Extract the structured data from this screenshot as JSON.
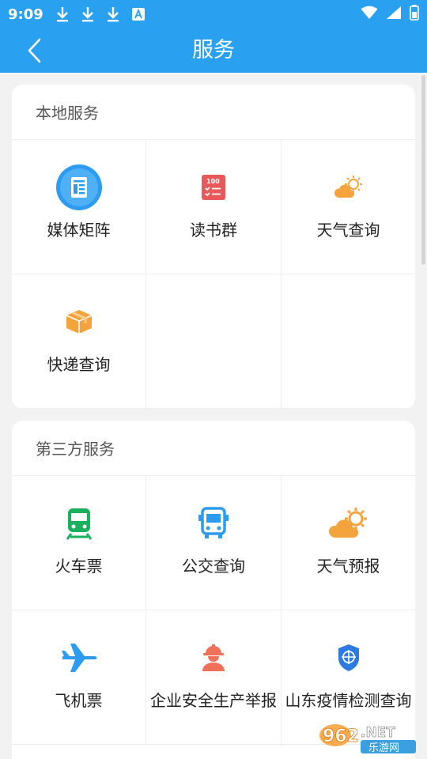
{
  "status_bar": {
    "time": "9:09",
    "left_icons": [
      "download-icon",
      "download-icon",
      "download-icon",
      "a-badge-icon"
    ],
    "right_icons": [
      "wifi-icon",
      "signal-icon",
      "battery-icon"
    ]
  },
  "app_bar": {
    "title": "服务",
    "back_icon": "chevron-left-icon",
    "background": "#2aa1f0"
  },
  "local_services": {
    "title": "本地服务",
    "items": [
      {
        "label": "媒体矩阵",
        "icon": "media-matrix-icon",
        "color": "#2d9cf0"
      },
      {
        "label": "读书群",
        "icon": "book-checklist-icon",
        "color": "#e85a5a"
      },
      {
        "label": "天气查询",
        "icon": "weather-icon",
        "color": "#f5a33c"
      },
      {
        "label": "快递查询",
        "icon": "package-icon",
        "color": "#f5a33c"
      }
    ]
  },
  "third_party_services": {
    "title": "第三方服务",
    "items": [
      {
        "label": "火车票",
        "icon": "train-icon",
        "color": "#19b15c"
      },
      {
        "label": "公交查询",
        "icon": "bus-icon",
        "color": "#2d9cf0"
      },
      {
        "label": "天气预报",
        "icon": "weather-icon",
        "color": "#f5a33c"
      },
      {
        "label": "飞机票",
        "icon": "airplane-icon",
        "color": "#2d9cf0"
      },
      {
        "label": "企业安全生产举报",
        "icon": "worker-helmet-icon",
        "color": "#f0705a"
      },
      {
        "label": "山东疫情检测查询",
        "icon": "shield-icon",
        "color": "#2d7be0"
      }
    ]
  },
  "watermark": {
    "text": "962.NET",
    "subtext": "乐游网"
  }
}
